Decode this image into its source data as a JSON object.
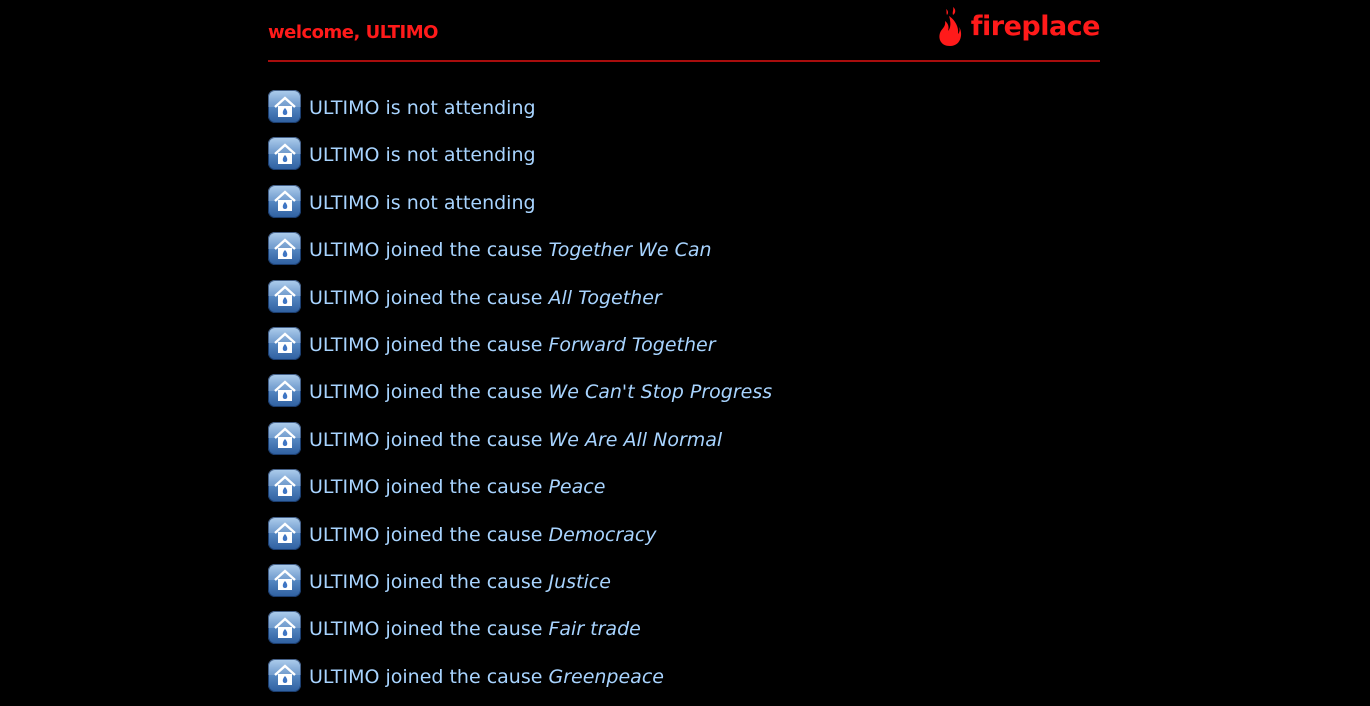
{
  "header": {
    "welcome": "welcome, ULTIMO",
    "logo_text": "fireplace",
    "logo_icon": "flame-icon",
    "accent_color": "#ff1a1a"
  },
  "feed": {
    "icon": "home-flame-app-icon",
    "items": [
      {
        "text": "ULTIMO is not attending",
        "cause": ""
      },
      {
        "text": "ULTIMO is not attending",
        "cause": ""
      },
      {
        "text": "ULTIMO is not attending",
        "cause": ""
      },
      {
        "text": "ULTIMO joined the cause ",
        "cause": "Together We Can"
      },
      {
        "text": "ULTIMO joined the cause ",
        "cause": "All Together"
      },
      {
        "text": "ULTIMO joined the cause ",
        "cause": "Forward Together"
      },
      {
        "text": "ULTIMO joined the cause ",
        "cause": "We Can't Stop Progress"
      },
      {
        "text": "ULTIMO joined the cause ",
        "cause": "We Are All Normal"
      },
      {
        "text": "ULTIMO joined the cause ",
        "cause": "Peace"
      },
      {
        "text": "ULTIMO joined the cause ",
        "cause": "Democracy"
      },
      {
        "text": "ULTIMO joined the cause ",
        "cause": "Justice"
      },
      {
        "text": "ULTIMO joined the cause ",
        "cause": "Fair trade"
      },
      {
        "text": "ULTIMO joined the cause ",
        "cause": "Greenpeace"
      }
    ]
  }
}
